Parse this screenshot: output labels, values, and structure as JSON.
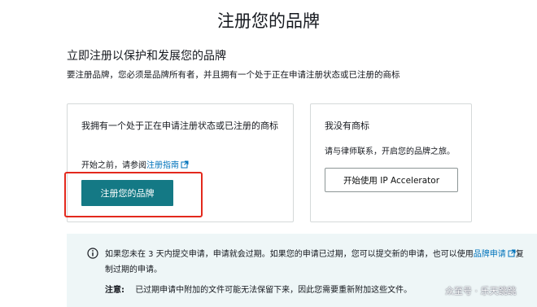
{
  "page": {
    "title": "注册您的品牌"
  },
  "intro": {
    "heading": "立即注册以保护和发展您的品牌",
    "subtext": "要注册品牌，您必须是品牌所有者，并且拥有一个处于正在申请注册状态或已注册的商标"
  },
  "card_owned": {
    "title": "我拥有一个处于正在申请注册状态或已注册的商标",
    "note_prefix": "开始之前，请参阅",
    "guide_link": "注册指南",
    "button_label": "注册您的品牌"
  },
  "card_none": {
    "title": "我没有商标",
    "note": "请与律师联系，开启您的品牌之旅。",
    "button_label": "开始使用 IP Accelerator"
  },
  "alert": {
    "text_part1": "如果您未在 3 天内提交申请，申请就会过期。如果您的申请已过期，您可以提交新的申请，也可以使用",
    "link": "品牌申请",
    "text_part2": "复制过期的申请。",
    "note_label": "注意:",
    "note_text": "已过期申请中附加的文件可能无法保留下来，因此您需要重新附加这些文件。"
  },
  "watermark": "众至号 · 乐天跳跳",
  "colors": {
    "primary_button": "#147985",
    "highlight_border": "#e3291d",
    "link": "#0073bb",
    "alert_bg": "#eef6f7"
  },
  "icons": [
    "external-link-icon",
    "info-icon"
  ]
}
